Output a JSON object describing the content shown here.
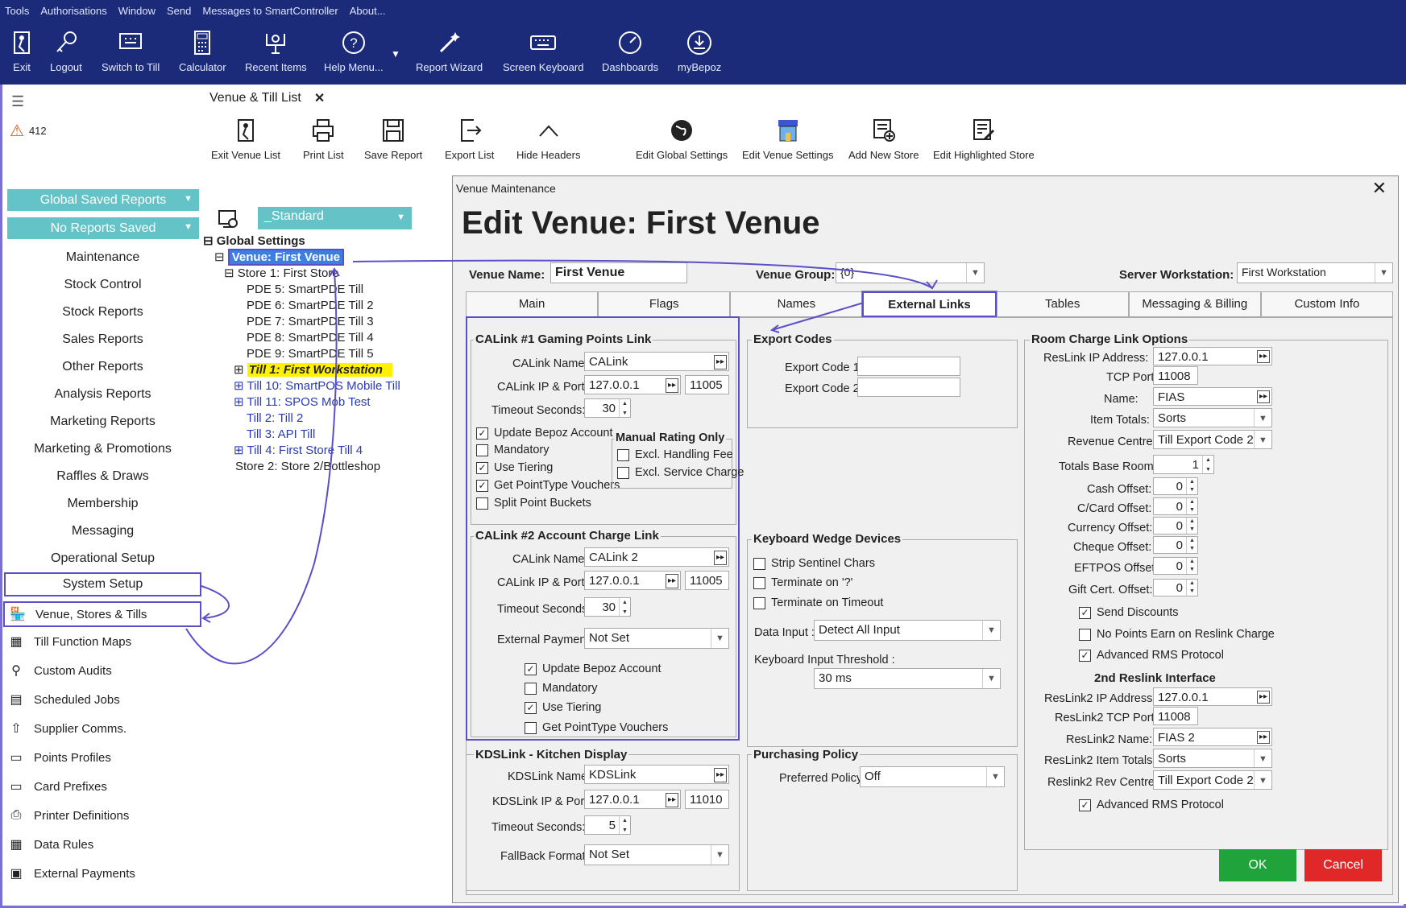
{
  "menubar": [
    "Tools",
    "Authorisations",
    "Window",
    "Send",
    "Messages to SmartController",
    "About..."
  ],
  "toolbar": [
    {
      "label": "Exit",
      "icon": "exit-icon"
    },
    {
      "label": "Logout",
      "icon": "key-icon"
    },
    {
      "label": "Switch to Till",
      "icon": "till-icon"
    },
    {
      "label": "Calculator",
      "icon": "calculator-icon"
    },
    {
      "label": "Recent Items",
      "icon": "recent-icon"
    },
    {
      "label": "Help Menu...",
      "icon": "help-icon"
    },
    {
      "label": "Report Wizard",
      "icon": "wizard-icon"
    },
    {
      "label": "Screen Keyboard",
      "icon": "keyboard-icon"
    },
    {
      "label": "Dashboards",
      "icon": "dashboard-icon"
    },
    {
      "label": "myBepoz",
      "icon": "mybepoz-icon"
    }
  ],
  "sidebar": {
    "alert_count": "412",
    "global_saved_reports": "Global Saved Reports",
    "no_reports_saved": "No Reports Saved",
    "items": [
      "Maintenance",
      "Stock Control",
      "Stock Reports",
      "Sales Reports",
      "Other Reports",
      "Analysis Reports",
      "Marketing Reports",
      "Marketing & Promotions",
      "Raffles & Draws",
      "Membership",
      "Messaging",
      "Operational Setup",
      "System Setup"
    ],
    "icon_items": [
      "Venue, Stores & Tills",
      "Till Function Maps",
      "Custom Audits",
      "Scheduled Jobs",
      "Supplier Comms.",
      "Points Profiles",
      "Card Prefixes",
      "Printer Definitions",
      "Data Rules",
      "External Payments"
    ]
  },
  "doc_tab": "Venue & Till List",
  "doc_tools": [
    "Exit Venue List",
    "Print List",
    "Save Report",
    "Export List",
    "Hide Headers",
    "Edit Global Settings",
    "Edit Venue Settings",
    "Add New Store",
    "Edit Highlighted Store"
  ],
  "std_select": "_Standard",
  "tree": [
    "Global Settings",
    "Venue: First Venue",
    "Store 1: First Store",
    "PDE 5: SmartPDE Till",
    "PDE 6: SmartPDE Till 2",
    "PDE 7: SmartPDE Till 3",
    "PDE 8: SmartPDE Till 4",
    "PDE 9: SmartPDE Till 5",
    "Till 1: First Workstation",
    "Till 10: SmartPOS Mobile Till",
    "Till 11: SPOS Mob Test",
    "Till 2: Till 2",
    "Till 3: API Till",
    "Till 4: First Store Till 4",
    "Store 2: Store 2/Bottleshop"
  ],
  "dialog": {
    "title": "Venue Maintenance",
    "heading": "Edit Venue: First Venue",
    "venue_name_label": "Venue Name:",
    "venue_name": "First Venue",
    "venue_group_label": "Venue Group:",
    "venue_group": "{0}",
    "server_ws_label": "Server Workstation:",
    "server_ws": "First Workstation",
    "tabs": [
      "Main",
      "Flags",
      "Names",
      "External Links",
      "Tables",
      "Messaging & Billing",
      "Custom Info"
    ],
    "calink1": {
      "title": "CALink #1 Gaming Points Link",
      "name_label": "CALink Name:",
      "name": "CALink",
      "ip_label": "CALink IP & Port:",
      "ip": "127.0.0.1",
      "port": "11005",
      "timeout_label": "Timeout Seconds:",
      "timeout": "30",
      "checks": [
        "Update Bepoz Account",
        "Mandatory",
        "Use Tiering",
        "Get PointType Vouchers",
        "Split Point Buckets"
      ],
      "manual_title": "Manual Rating Only",
      "manual_checks": [
        "Excl. Handling Fee",
        "Excl. Service Charge"
      ]
    },
    "calink2": {
      "title": "CALink #2 Account Charge Link",
      "name_label": "CALink Name:",
      "name": "CALink 2",
      "ip_label": "CALink IP & Port:",
      "ip": "127.0.0.1",
      "port": "11005",
      "timeout_label": "Timeout Seconds:",
      "timeout": "30",
      "payment_label": "External Payment:",
      "payment": "Not Set",
      "checks": [
        "Update Bepoz Account",
        "Mandatory",
        "Use Tiering",
        "Get PointType Vouchers"
      ]
    },
    "kds": {
      "title": "KDSLink - Kitchen Display",
      "name_label": "KDSLink Name:",
      "name": "KDSLink",
      "ip_label": "KDSLink IP & Port:",
      "ip": "127.0.0.1",
      "port": "11010",
      "timeout_label": "Timeout Seconds:",
      "timeout": "5",
      "fallback_label": "FallBack Format:",
      "fallback": "Not Set"
    },
    "export": {
      "title": "Export Codes",
      "code1_label": "Export Code 1:",
      "code2_label": "Export Code 2:"
    },
    "wedge": {
      "title": "Keyboard Wedge Devices",
      "checks": [
        "Strip Sentinel Chars",
        "Terminate on '?'",
        "Terminate on Timeout"
      ],
      "data_input_label": "Data Input :",
      "data_input": "Detect All Input",
      "threshold_label": "Keyboard Input Threshold :",
      "threshold": "30 ms"
    },
    "purchasing": {
      "title": "Purchasing Policy",
      "label": "Preferred Policy:",
      "value": "Off"
    },
    "room": {
      "title": "Room Charge Link Options",
      "ip_label": "ResLink  IP Address:",
      "ip": "127.0.0.1",
      "tcp_label": "TCP Port:",
      "tcp": "11008",
      "name_label": "Name:",
      "name": "FIAS",
      "totals_label": "Item Totals:",
      "totals": "Sorts",
      "rev_label": "Revenue Centre:",
      "rev": "Till Export Code 2",
      "base_label": "Totals Base Room:",
      "base": "1",
      "offsets": [
        {
          "label": "Cash Offset:",
          "value": "0"
        },
        {
          "label": "C/Card Offset:",
          "value": "0"
        },
        {
          "label": "Currency Offset:",
          "value": "0"
        },
        {
          "label": "Cheque Offset:",
          "value": "0"
        },
        {
          "label": "EFTPOS Offset:",
          "value": "0"
        },
        {
          "label": "Gift Cert. Offset:",
          "value": "0"
        }
      ],
      "checks": [
        "Send Discounts",
        "No Points Earn on Reslink Charge",
        "Advanced RMS Protocol"
      ],
      "second_title": "2nd Reslink Interface",
      "ip2_label": "ResLink2  IP Address:",
      "ip2": "127.0.0.1",
      "tcp2_label": "ResLink2 TCP Port:",
      "tcp2": "11008",
      "name2_label": "ResLink2 Name:",
      "name2": "FIAS 2",
      "totals2_label": "ResLink2 Item Totals:",
      "totals2": "Sorts",
      "rev2_label": "Reslink2 Rev Centre:",
      "rev2": "Till Export Code 2",
      "check2": "Advanced RMS Protocol"
    },
    "ok": "OK",
    "cancel": "Cancel"
  },
  "colors": {
    "topbar": "#1b2b7a",
    "teal": "#63c3c6",
    "highlight": "#5a4fc9",
    "ok": "#1fa33a",
    "cancel": "#e02828",
    "tree_link": "#2a3ab5",
    "tree_selected": "#3d7fe0"
  }
}
